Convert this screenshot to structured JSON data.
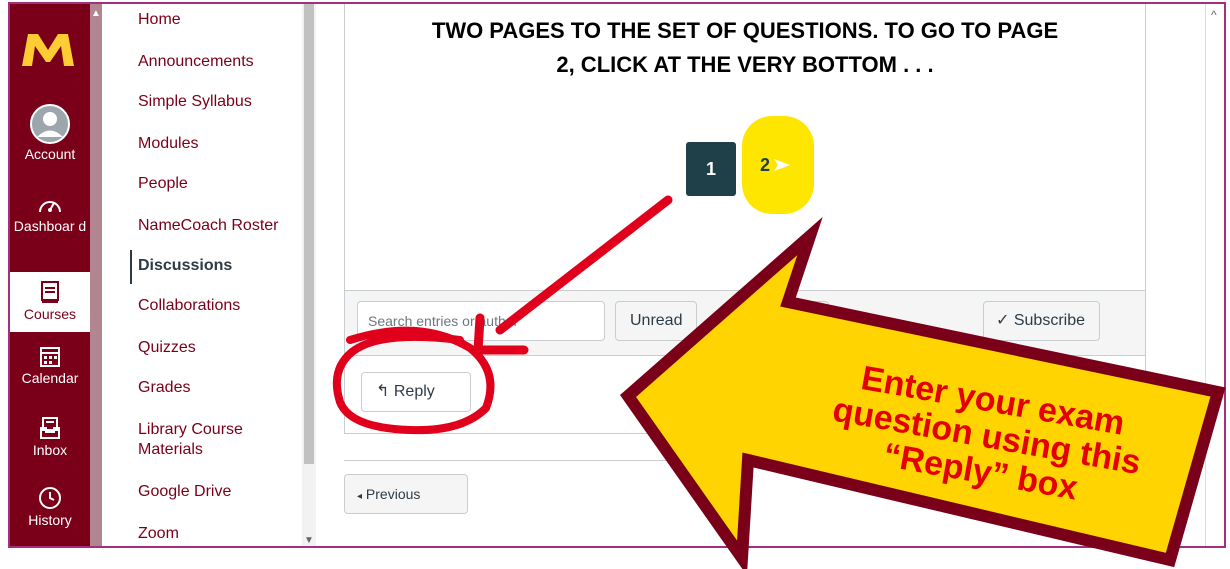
{
  "global_nav": {
    "logo": "M",
    "items": [
      {
        "label": "Account",
        "icon": "account-icon"
      },
      {
        "label": "Dashboar d",
        "icon": "dashboard-icon"
      },
      {
        "label": "Courses",
        "icon": "courses-icon",
        "active": true
      },
      {
        "label": "Calendar",
        "icon": "calendar-icon"
      },
      {
        "label": "Inbox",
        "icon": "inbox-icon"
      },
      {
        "label": "History",
        "icon": "history-icon"
      }
    ],
    "colors": {
      "bg": "#7a0019",
      "accent": "#ffcc33"
    }
  },
  "course_nav": {
    "items": [
      {
        "label": "Home"
      },
      {
        "label": "Announcements"
      },
      {
        "label": "Simple Syllabus"
      },
      {
        "label": "Modules"
      },
      {
        "label": "People"
      },
      {
        "label": "NameCoach Roster"
      },
      {
        "label": "Discussions",
        "active": true
      },
      {
        "label": "Collaborations"
      },
      {
        "label": "Quizzes"
      },
      {
        "label": "Grades"
      },
      {
        "label": "Library Course Materials"
      },
      {
        "label": "Google Drive"
      },
      {
        "label": "Zoom"
      }
    ]
  },
  "main": {
    "heading_line1": "TWO PAGES TO THE SET OF QUESTIONS.  TO GO TO PAGE",
    "heading_line2": "2, CLICK AT THE VERY BOTTOM . . .",
    "pager": {
      "page1": "1",
      "page2": "2"
    },
    "toolbar": {
      "search_placeholder": "Search entries or author",
      "unread_label": "Unread",
      "subscribe_label": "Subscribe"
    },
    "reply_label": "Reply",
    "previous_label": "Previous"
  },
  "annotation": {
    "line1": "Enter your exam",
    "line2": "question using this",
    "line3": "“Reply” box",
    "colors": {
      "arrow_fill": "#ffd400",
      "arrow_stroke": "#7a0019",
      "text": "#e30000",
      "pen": "#e0001b"
    }
  }
}
